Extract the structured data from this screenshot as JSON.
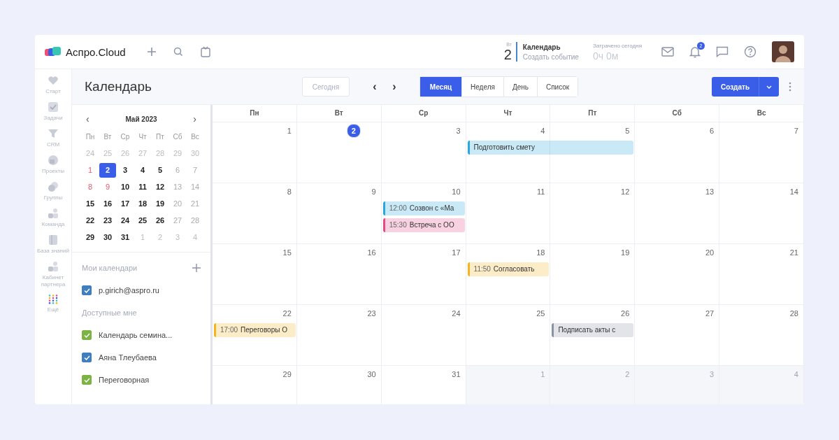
{
  "topbar": {
    "logo": "Аспро.Cloud",
    "weekday": "Вт",
    "day": "2",
    "module": "Календарь",
    "create_event": "Создать событие",
    "spent_label": "Затрачено сегодня",
    "spent_value": "0ч 0м",
    "notifications": "2"
  },
  "nav": [
    {
      "label": "Старт"
    },
    {
      "label": "Задачи"
    },
    {
      "label": "CRM"
    },
    {
      "label": "Проекты"
    },
    {
      "label": "Группы"
    },
    {
      "label": "Команда"
    },
    {
      "label": "База знаний"
    },
    {
      "label": "Кабинет партнера"
    },
    {
      "label": "Ещё"
    }
  ],
  "page_title": "Календарь",
  "toolbar": {
    "today": "Сегодня",
    "prev": "‹",
    "next": "›",
    "views": [
      {
        "label": "Месяц",
        "selected": true
      },
      {
        "label": "Неделя",
        "selected": false
      },
      {
        "label": "День",
        "selected": false
      },
      {
        "label": "Список",
        "selected": false
      }
    ],
    "create": "Создать"
  },
  "mini_calendar": {
    "title": "Май 2023",
    "prev": "‹",
    "next": "›",
    "weekdays": [
      "Пн",
      "Вт",
      "Ср",
      "Чт",
      "Пт",
      "Сб",
      "Вс"
    ],
    "days": [
      {
        "n": "24",
        "kind": "out",
        "selected": false
      },
      {
        "n": "25",
        "kind": "out",
        "selected": false
      },
      {
        "n": "26",
        "kind": "out",
        "selected": false
      },
      {
        "n": "27",
        "kind": "out",
        "selected": false
      },
      {
        "n": "28",
        "kind": "out",
        "selected": false
      },
      {
        "n": "29",
        "kind": "out",
        "selected": false
      },
      {
        "n": "30",
        "kind": "out",
        "selected": false
      },
      {
        "n": "1",
        "kind": "holiday",
        "selected": false
      },
      {
        "n": "2",
        "kind": "work",
        "selected": true
      },
      {
        "n": "3",
        "kind": "work",
        "selected": false
      },
      {
        "n": "4",
        "kind": "work",
        "selected": false
      },
      {
        "n": "5",
        "kind": "work",
        "selected": false
      },
      {
        "n": "6",
        "kind": "weekend",
        "selected": false
      },
      {
        "n": "7",
        "kind": "weekend",
        "selected": false
      },
      {
        "n": "8",
        "kind": "holiday",
        "selected": false
      },
      {
        "n": "9",
        "kind": "holiday",
        "selected": false
      },
      {
        "n": "10",
        "kind": "work",
        "selected": false
      },
      {
        "n": "11",
        "kind": "work",
        "selected": false
      },
      {
        "n": "12",
        "kind": "work",
        "selected": false
      },
      {
        "n": "13",
        "kind": "weekend",
        "selected": false
      },
      {
        "n": "14",
        "kind": "weekend",
        "selected": false
      },
      {
        "n": "15",
        "kind": "work",
        "selected": false
      },
      {
        "n": "16",
        "kind": "work",
        "selected": false
      },
      {
        "n": "17",
        "kind": "work",
        "selected": false
      },
      {
        "n": "18",
        "kind": "work",
        "selected": false
      },
      {
        "n": "19",
        "kind": "work",
        "selected": false
      },
      {
        "n": "20",
        "kind": "weekend",
        "selected": false
      },
      {
        "n": "21",
        "kind": "weekend",
        "selected": false
      },
      {
        "n": "22",
        "kind": "work",
        "selected": false
      },
      {
        "n": "23",
        "kind": "work",
        "selected": false
      },
      {
        "n": "24",
        "kind": "work",
        "selected": false
      },
      {
        "n": "25",
        "kind": "work",
        "selected": false
      },
      {
        "n": "26",
        "kind": "work",
        "selected": false
      },
      {
        "n": "27",
        "kind": "weekend",
        "selected": false
      },
      {
        "n": "28",
        "kind": "weekend",
        "selected": false
      },
      {
        "n": "29",
        "kind": "work",
        "selected": false
      },
      {
        "n": "30",
        "kind": "work",
        "selected": false
      },
      {
        "n": "31",
        "kind": "work",
        "selected": false
      },
      {
        "n": "1",
        "kind": "out",
        "selected": false
      },
      {
        "n": "2",
        "kind": "out",
        "selected": false
      },
      {
        "n": "3",
        "kind": "out",
        "selected": false
      },
      {
        "n": "4",
        "kind": "out",
        "selected": false
      }
    ]
  },
  "my_calendars": {
    "title": "Мои календари",
    "items": [
      {
        "label": "p.girich@aspro.ru",
        "checked": true,
        "color": "#3f7fc1"
      }
    ]
  },
  "shared_calendars": {
    "title": "Доступные мне",
    "items": [
      {
        "label": "Календарь семина...",
        "checked": true,
        "color": "#7cb342"
      },
      {
        "label": "Аяна Тлеубаева",
        "checked": true,
        "color": "#3f7fc1"
      },
      {
        "label": "Переговорная",
        "checked": true,
        "color": "#7cb342"
      }
    ]
  },
  "month": {
    "weekdays": [
      "Пн",
      "Вт",
      "Ср",
      "Чт",
      "Пт",
      "Сб",
      "Вс"
    ],
    "weeks": [
      {
        "days": [
          {
            "n": "1",
            "today": false,
            "other_month": false
          },
          {
            "n": "2",
            "today": true,
            "other_month": false
          },
          {
            "n": "3",
            "today": false,
            "other_month": false
          },
          {
            "n": "4",
            "today": false,
            "other_month": false,
            "events": [
              {
                "title": "Подготовить смету",
                "color": "#29a8e0"
              }
            ]
          },
          {
            "n": "5",
            "today": false,
            "other_month": false
          },
          {
            "n": "6",
            "today": false,
            "other_month": false
          },
          {
            "n": "7",
            "today": false,
            "other_month": false
          }
        ]
      },
      {
        "days": [
          {
            "n": "8",
            "today": false,
            "other_month": false
          },
          {
            "n": "9",
            "today": false,
            "other_month": false
          },
          {
            "n": "10",
            "today": false,
            "other_month": false,
            "events": [
              {
                "time": "12:00",
                "title": "Созвон с «Ма",
                "color": "#29a8e0"
              },
              {
                "time": "15:30",
                "title": "Встреча с ОО",
                "color": "#e84a86"
              }
            ]
          },
          {
            "n": "11",
            "today": false,
            "other_month": false
          },
          {
            "n": "12",
            "today": false,
            "other_month": false
          },
          {
            "n": "13",
            "today": false,
            "other_month": false
          },
          {
            "n": "14",
            "today": false,
            "other_month": false
          }
        ]
      },
      {
        "days": [
          {
            "n": "15",
            "today": false,
            "other_month": false
          },
          {
            "n": "16",
            "today": false,
            "other_month": false
          },
          {
            "n": "17",
            "today": false,
            "other_month": false
          },
          {
            "n": "18",
            "today": false,
            "other_month": false,
            "events": [
              {
                "time": "11:50",
                "title": "Согласовать",
                "color": "#f5b320"
              }
            ]
          },
          {
            "n": "19",
            "today": false,
            "other_month": false
          },
          {
            "n": "20",
            "today": false,
            "other_month": false
          },
          {
            "n": "21",
            "today": false,
            "other_month": false
          }
        ]
      },
      {
        "days": [
          {
            "n": "22",
            "today": false,
            "other_month": false,
            "events": [
              {
                "time": "17:00",
                "title": "Переговоры О",
                "color": "#f5b320"
              }
            ]
          },
          {
            "n": "23",
            "today": false,
            "other_month": false
          },
          {
            "n": "24",
            "today": false,
            "other_month": false
          },
          {
            "n": "25",
            "today": false,
            "other_month": false
          },
          {
            "n": "26",
            "today": false,
            "other_month": false,
            "events": [
              {
                "title": "Подписать акты с",
                "color": "#8a94a6"
              }
            ]
          },
          {
            "n": "27",
            "today": false,
            "other_month": false
          },
          {
            "n": "28",
            "today": false,
            "other_month": false
          }
        ]
      },
      {
        "days": [
          {
            "n": "29",
            "today": false,
            "other_month": false
          },
          {
            "n": "30",
            "today": false,
            "other_month": false
          },
          {
            "n": "31",
            "today": false,
            "other_month": false
          },
          {
            "n": "1",
            "today": false,
            "other_month": true
          },
          {
            "n": "2",
            "today": false,
            "other_month": true
          },
          {
            "n": "3",
            "today": false,
            "other_month": true
          },
          {
            "n": "4",
            "today": false,
            "other_month": true
          }
        ]
      }
    ]
  }
}
